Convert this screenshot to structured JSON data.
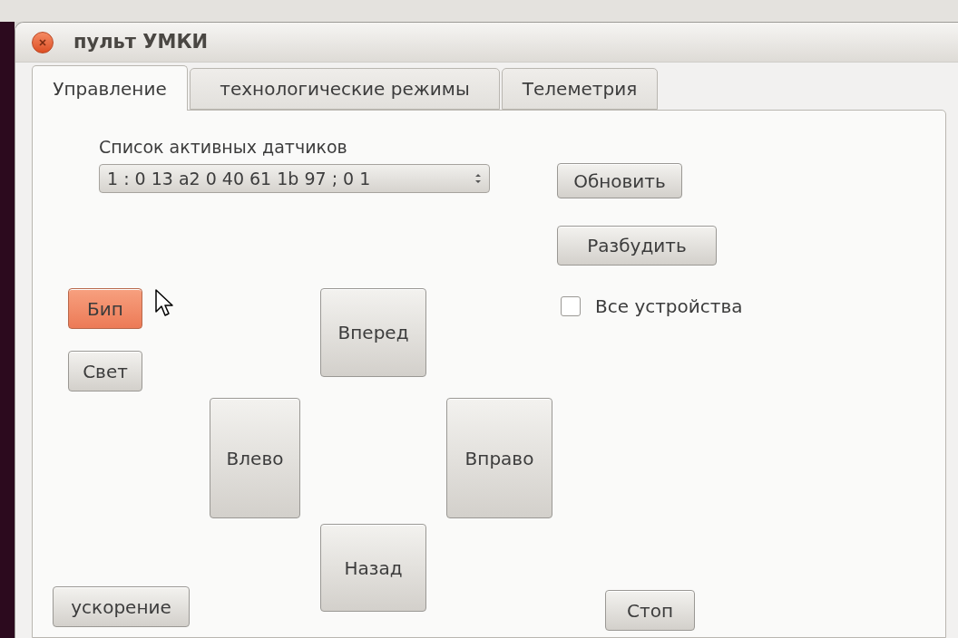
{
  "window": {
    "title": "пульт УМКИ"
  },
  "tabs": [
    {
      "label": "Управление",
      "selected": true
    },
    {
      "label": "технологические режимы",
      "selected": false
    },
    {
      "label": "Телеметрия",
      "selected": false
    }
  ],
  "sensor_list": {
    "label": "Список активных датчиков",
    "value": "1 : 0 13 a2 0 40 61 1b 97 ; 0 1"
  },
  "refresh_button": {
    "label": "Обновить"
  },
  "wake_button": {
    "label": "Разбудить"
  },
  "all_devices": {
    "label": "Все устройства",
    "checked": false
  },
  "beep_button": {
    "label": "Бип",
    "hovered": true
  },
  "light_button": {
    "label": "Свет",
    "hovered": false
  },
  "forward_button": {
    "label": "Вперед"
  },
  "left_button": {
    "label": "Влево"
  },
  "right_button": {
    "label": "Вправо"
  },
  "back_button": {
    "label": "Назад"
  },
  "acceleration_button": {
    "label": "ускорение"
  },
  "stop_button": {
    "label": "Стоп"
  }
}
